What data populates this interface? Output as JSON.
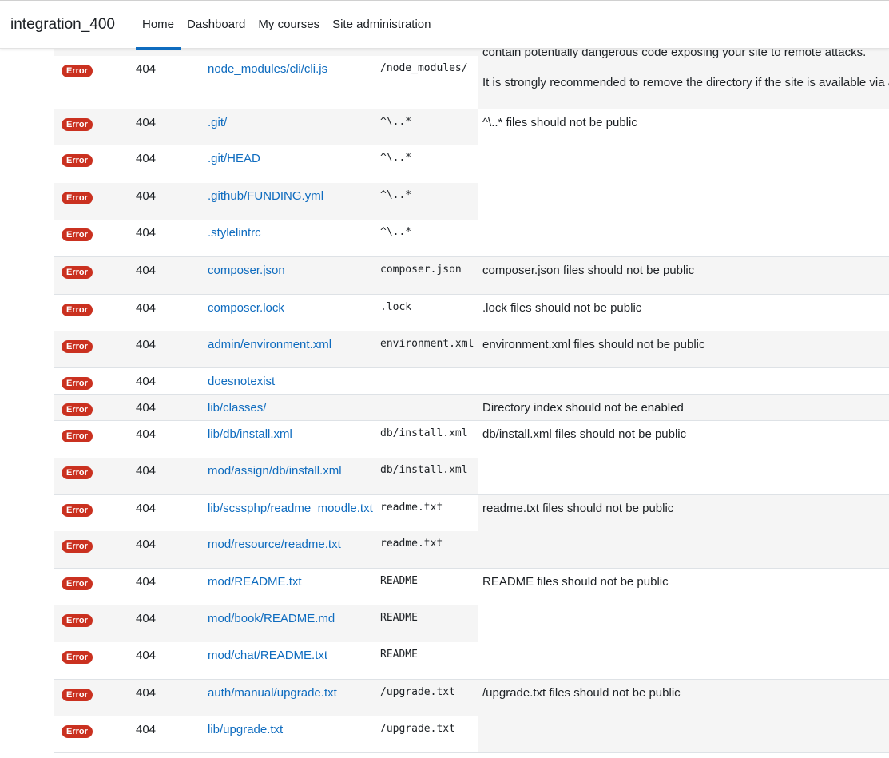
{
  "navbar": {
    "brand": "integration_400",
    "links": [
      "Home",
      "Dashboard",
      "My courses",
      "Site administration"
    ],
    "active_index": 0
  },
  "rows": [
    {
      "status": "Error",
      "code": "404",
      "url": "node_modules/cli/cli.js",
      "pattern": "/node_modules/"
    },
    {
      "status": "Error",
      "code": "404",
      "url": ".git/",
      "pattern": "^\\..*"
    },
    {
      "status": "Error",
      "code": "404",
      "url": ".git/HEAD",
      "pattern": "^\\..*"
    },
    {
      "status": "Error",
      "code": "404",
      "url": ".github/FUNDING.yml",
      "pattern": "^\\..*"
    },
    {
      "status": "Error",
      "code": "404",
      "url": ".stylelintrc",
      "pattern": "^\\..*"
    },
    {
      "status": "Error",
      "code": "404",
      "url": "composer.json",
      "pattern": "composer.json"
    },
    {
      "status": "Error",
      "code": "404",
      "url": "composer.lock",
      "pattern": ".lock"
    },
    {
      "status": "Error",
      "code": "404",
      "url": "admin/environment.xml",
      "pattern": "environment.xml"
    },
    {
      "status": "Error",
      "code": "404",
      "url": "doesnotexist",
      "pattern": ""
    },
    {
      "status": "Error",
      "code": "404",
      "url": "lib/classes/",
      "pattern": ""
    },
    {
      "status": "Error",
      "code": "404",
      "url": "lib/db/install.xml",
      "pattern": "db/install.xml"
    },
    {
      "status": "Error",
      "code": "404",
      "url": "mod/assign/db/install.xml",
      "pattern": "db/install.xml"
    },
    {
      "status": "Error",
      "code": "404",
      "url": "lib/scssphp/readme_moodle.txt",
      "pattern": "readme.txt"
    },
    {
      "status": "Error",
      "code": "404",
      "url": "mod/resource/readme.txt",
      "pattern": "readme.txt"
    },
    {
      "status": "Error",
      "code": "404",
      "url": "mod/README.txt",
      "pattern": "README"
    },
    {
      "status": "Error",
      "code": "404",
      "url": "mod/book/README.md",
      "pattern": "README"
    },
    {
      "status": "Error",
      "code": "404",
      "url": "mod/chat/README.txt",
      "pattern": "README"
    },
    {
      "status": "Error",
      "code": "404",
      "url": "auth/manual/upgrade.txt",
      "pattern": "/upgrade.txt"
    },
    {
      "status": "Error",
      "code": "404",
      "url": "lib/upgrade.txt",
      "pattern": "/upgrade.txt"
    }
  ],
  "descriptions": [
    {
      "lines": [
        "contain potentially dangerous code exposing your site to remote attacks.",
        "It is strongly recommended to remove the directory if the site is available via a public URL."
      ]
    },
    {
      "lines": [
        "^\\..* files should not be public"
      ]
    },
    {
      "lines": [
        "composer.json files should not be public"
      ]
    },
    {
      "lines": [
        ".lock files should not be public"
      ]
    },
    {
      "lines": [
        "environment.xml files should not be public"
      ]
    },
    {
      "lines": [
        ""
      ]
    },
    {
      "lines": [
        "Directory index should not be enabled"
      ]
    },
    {
      "lines": [
        "db/install.xml files should not be public"
      ]
    },
    {
      "lines": [
        "readme.txt files should not be public"
      ]
    },
    {
      "lines": [
        "README files should not be public"
      ]
    },
    {
      "lines": [
        "/upgrade.txt files should not be public"
      ]
    }
  ]
}
